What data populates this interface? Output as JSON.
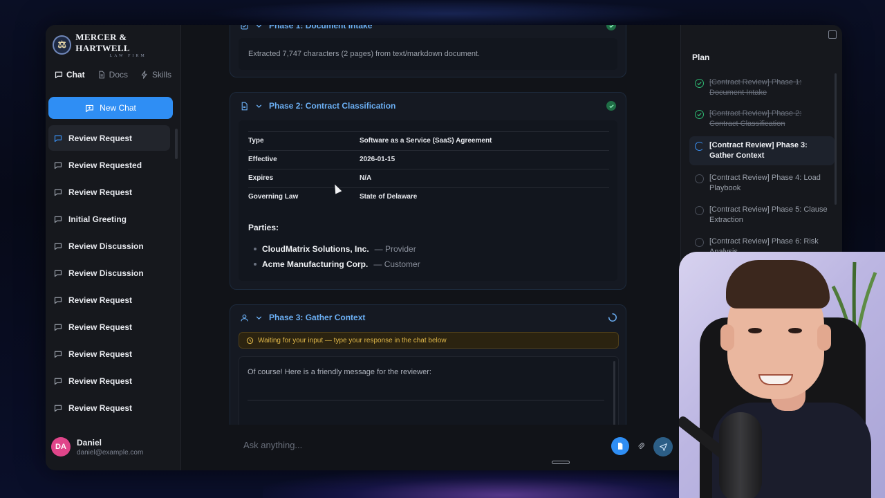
{
  "brand": {
    "name": "MERCER & HARTWELL",
    "subtitle": "LAW FIRM"
  },
  "sidebar": {
    "tabs": [
      {
        "label": "Chat",
        "icon": "chat-icon",
        "active": true
      },
      {
        "label": "Docs",
        "icon": "document-icon",
        "active": false
      },
      {
        "label": "Skills",
        "icon": "lightning-icon",
        "active": false
      }
    ],
    "new_chat_label": "New Chat",
    "chats": [
      "Review Request",
      "Review Requested",
      "Review Request",
      "Initial Greeting",
      "Review Discussion",
      "Review Discussion",
      "Review Request",
      "Review Request",
      "Review Request",
      "Review Request",
      "Review Request"
    ],
    "user": {
      "initials": "DA",
      "name": "Daniel",
      "email": "daniel@example.com"
    }
  },
  "phases": {
    "phase1": {
      "title": "Phase 1: Document Intake",
      "summary": "Extracted 7,747 characters (2 pages) from text/markdown document."
    },
    "phase2": {
      "title": "Phase 2: Contract Classification",
      "rows": [
        {
          "label": "Type",
          "value": "Software as a Service (SaaS) Agreement"
        },
        {
          "label": "Effective",
          "value": "2026-01-15"
        },
        {
          "label": "Expires",
          "value": "N/A"
        },
        {
          "label": "Governing Law",
          "value": "State of Delaware"
        }
      ],
      "parties_label": "Parties:",
      "parties": [
        {
          "name": "CloudMatrix Solutions, Inc.",
          "role": "— Provider"
        },
        {
          "name": "Acme Manufacturing Corp.",
          "role": "— Customer"
        }
      ]
    },
    "phase3": {
      "title": "Phase 3: Gather Context",
      "waiting": "Waiting for your input — type your response in the chat below",
      "reply": "Of course! Here is a friendly message for the reviewer:"
    }
  },
  "composer": {
    "placeholder": "Ask anything..."
  },
  "plan": {
    "title": "Plan",
    "steps": [
      {
        "label": "[Contract Review] Phase 1: Document Intake",
        "status": "done"
      },
      {
        "label": "[Contract Review] Phase 2: Contract Classification",
        "status": "done"
      },
      {
        "label": "[Contract Review] Phase 3: Gather Context",
        "status": "current"
      },
      {
        "label": "[Contract Review] Phase 4: Load Playbook",
        "status": "pending"
      },
      {
        "label": "[Contract Review] Phase 5: Clause Extraction",
        "status": "pending"
      },
      {
        "label": "[Contract Review] Phase 6: Risk Analysis",
        "status": "pending"
      }
    ]
  },
  "colors": {
    "accent": "#2f8ef4",
    "phase_title": "#6cb0f5",
    "success": "#2eb872",
    "warning": "#e2b94a",
    "avatar": "#e0458a"
  }
}
